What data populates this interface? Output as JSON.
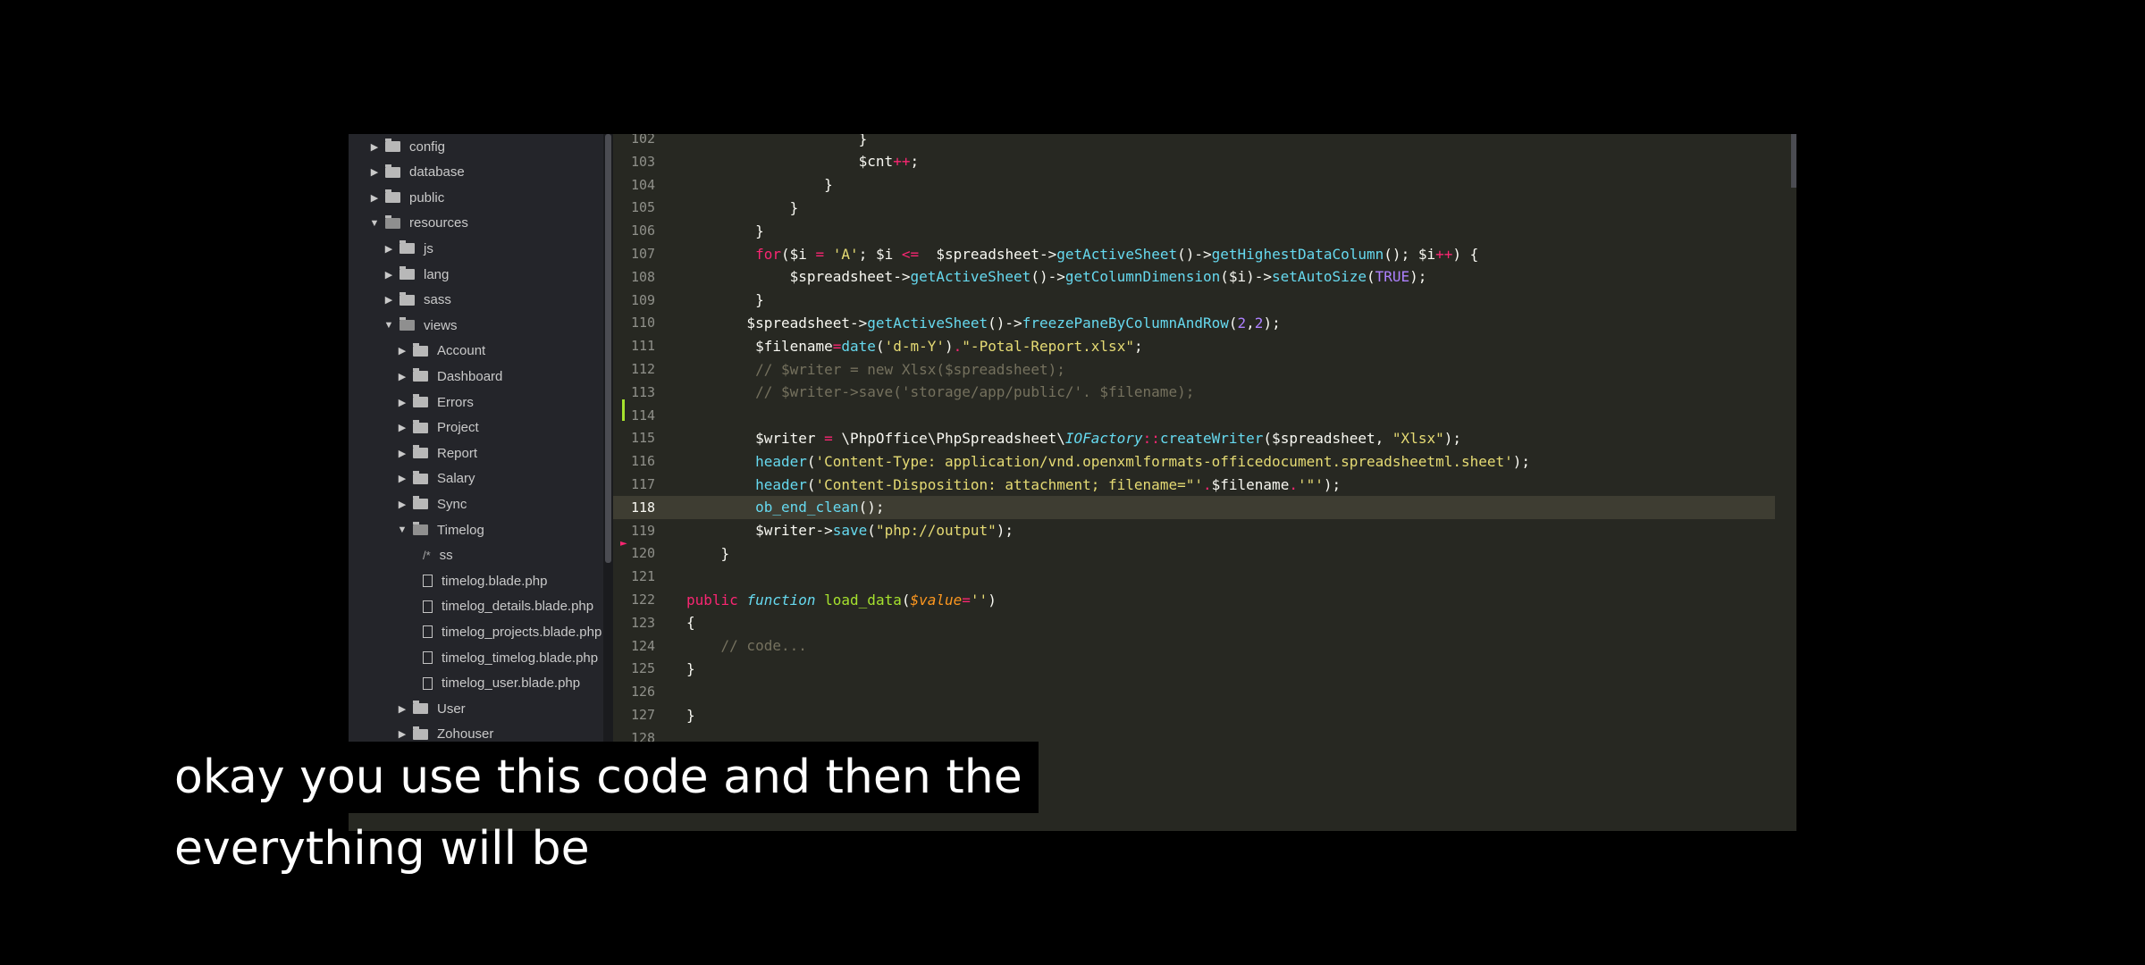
{
  "sidebar": {
    "items": [
      {
        "label": "config",
        "type": "folder",
        "depth": 0,
        "open": false
      },
      {
        "label": "database",
        "type": "folder",
        "depth": 0,
        "open": false
      },
      {
        "label": "public",
        "type": "folder",
        "depth": 0,
        "open": false
      },
      {
        "label": "resources",
        "type": "folder",
        "depth": 0,
        "open": true
      },
      {
        "label": "js",
        "type": "folder",
        "depth": 1,
        "open": false
      },
      {
        "label": "lang",
        "type": "folder",
        "depth": 1,
        "open": false
      },
      {
        "label": "sass",
        "type": "folder",
        "depth": 1,
        "open": false
      },
      {
        "label": "views",
        "type": "folder",
        "depth": 1,
        "open": true
      },
      {
        "label": "Account",
        "type": "folder",
        "depth": 2,
        "open": false
      },
      {
        "label": "Dashboard",
        "type": "folder",
        "depth": 2,
        "open": false
      },
      {
        "label": "Errors",
        "type": "folder",
        "depth": 2,
        "open": false
      },
      {
        "label": "Project",
        "type": "folder",
        "depth": 2,
        "open": false
      },
      {
        "label": "Report",
        "type": "folder",
        "depth": 2,
        "open": false
      },
      {
        "label": "Salary",
        "type": "folder",
        "depth": 2,
        "open": false
      },
      {
        "label": "Sync",
        "type": "folder",
        "depth": 2,
        "open": false
      },
      {
        "label": "Timelog",
        "type": "folder",
        "depth": 2,
        "open": true
      },
      {
        "label": "ss",
        "type": "comment",
        "depth": 3
      },
      {
        "label": "timelog.blade.php",
        "type": "file",
        "depth": 3
      },
      {
        "label": "timelog_details.blade.php",
        "type": "file",
        "depth": 3
      },
      {
        "label": "timelog_projects.blade.php",
        "type": "file",
        "depth": 3
      },
      {
        "label": "timelog_timelog.blade.php",
        "type": "file",
        "depth": 3
      },
      {
        "label": "timelog_user.blade.php",
        "type": "file",
        "depth": 3
      },
      {
        "label": "User",
        "type": "folder",
        "depth": 2,
        "open": false
      },
      {
        "label": "Zohouser",
        "type": "folder",
        "depth": 2,
        "open": false
      }
    ]
  },
  "editor": {
    "current_line": "118",
    "lines": [
      {
        "n": "102",
        "tokens": [
          [
            "var",
            "                    }"
          ]
        ]
      },
      {
        "n": "103",
        "tokens": [
          [
            "var",
            "                    $cnt"
          ],
          [
            "kw",
            "++"
          ],
          [
            "var",
            ";"
          ]
        ]
      },
      {
        "n": "104",
        "tokens": [
          [
            "var",
            "                }"
          ]
        ]
      },
      {
        "n": "105",
        "tokens": [
          [
            "var",
            "            }"
          ]
        ]
      },
      {
        "n": "106",
        "tokens": [
          [
            "var",
            "        }"
          ]
        ]
      },
      {
        "n": "107",
        "tokens": [
          [
            "var",
            "        "
          ],
          [
            "kw",
            "for"
          ],
          [
            "var",
            "($i "
          ],
          [
            "kw",
            "="
          ],
          [
            "var",
            " "
          ],
          [
            "str",
            "'A'"
          ],
          [
            "var",
            "; $i "
          ],
          [
            "kw",
            "<="
          ],
          [
            "var",
            "  $spreadsheet->"
          ],
          [
            "fn",
            "getActiveSheet"
          ],
          [
            "var",
            "()->"
          ],
          [
            "fn",
            "getHighestDataColumn"
          ],
          [
            "var",
            "(); $i"
          ],
          [
            "kw",
            "++"
          ],
          [
            "var",
            ") {"
          ]
        ]
      },
      {
        "n": "108",
        "tokens": [
          [
            "var",
            "            $spreadsheet->"
          ],
          [
            "fn",
            "getActiveSheet"
          ],
          [
            "var",
            "()->"
          ],
          [
            "fn",
            "getColumnDimension"
          ],
          [
            "var",
            "($i)->"
          ],
          [
            "fn",
            "setAutoSize"
          ],
          [
            "var",
            "("
          ],
          [
            "num",
            "TRUE"
          ],
          [
            "var",
            ");"
          ]
        ]
      },
      {
        "n": "109",
        "tokens": [
          [
            "var",
            "        }"
          ]
        ]
      },
      {
        "n": "110",
        "tokens": [
          [
            "var",
            "       $spreadsheet->"
          ],
          [
            "fn",
            "getActiveSheet"
          ],
          [
            "var",
            "()->"
          ],
          [
            "fn",
            "freezePaneByColumnAndRow"
          ],
          [
            "var",
            "("
          ],
          [
            "num",
            "2"
          ],
          [
            "var",
            ","
          ],
          [
            "num",
            "2"
          ],
          [
            "var",
            ");"
          ]
        ]
      },
      {
        "n": "111",
        "tokens": [
          [
            "var",
            "        $filename"
          ],
          [
            "kw",
            "="
          ],
          [
            "fn",
            "date"
          ],
          [
            "var",
            "("
          ],
          [
            "str",
            "'d-m-Y'"
          ],
          [
            "var",
            ")"
          ],
          [
            "kw",
            "."
          ],
          [
            "str",
            "\"-Potal-Report.xlsx\""
          ],
          [
            "var",
            ";"
          ]
        ]
      },
      {
        "n": "112",
        "tokens": [
          [
            "cmt",
            "        // $writer = new Xlsx($spreadsheet);"
          ]
        ]
      },
      {
        "n": "113",
        "tokens": [
          [
            "cmt",
            "        // $writer->save('storage/app/public/'. $filename);"
          ]
        ]
      },
      {
        "n": "114",
        "tokens": [
          [
            "var",
            ""
          ]
        ]
      },
      {
        "n": "115",
        "tokens": [
          [
            "var",
            "        $writer "
          ],
          [
            "kw",
            "="
          ],
          [
            "var",
            " \\PhpOffice\\PhpSpreadsheet\\"
          ],
          [
            "fn-italic",
            "IOFactory"
          ],
          [
            "kw",
            "::"
          ],
          [
            "fn",
            "createWriter"
          ],
          [
            "var",
            "($spreadsheet, "
          ],
          [
            "str",
            "\"Xlsx\""
          ],
          [
            "var",
            ");"
          ]
        ]
      },
      {
        "n": "116",
        "tokens": [
          [
            "var",
            "        "
          ],
          [
            "fn",
            "header"
          ],
          [
            "var",
            "("
          ],
          [
            "str",
            "'Content-Type: application/vnd.openxmlformats-officedocument.spreadsheetml.sheet'"
          ],
          [
            "var",
            ");"
          ]
        ]
      },
      {
        "n": "117",
        "tokens": [
          [
            "var",
            "        "
          ],
          [
            "fn",
            "header"
          ],
          [
            "var",
            "("
          ],
          [
            "str",
            "'Content-Disposition: attachment; filename=\"'"
          ],
          [
            "kw",
            "."
          ],
          [
            "var",
            "$filename"
          ],
          [
            "kw",
            "."
          ],
          [
            "str",
            "'\"'"
          ],
          [
            "var",
            ");"
          ]
        ]
      },
      {
        "n": "118",
        "tokens": [
          [
            "var",
            "        "
          ],
          [
            "fn",
            "ob_end_clean"
          ],
          [
            "var",
            "();"
          ]
        ]
      },
      {
        "n": "119",
        "tokens": [
          [
            "var",
            "        $writer->"
          ],
          [
            "fn",
            "save"
          ],
          [
            "var",
            "("
          ],
          [
            "str",
            "\"php://output\""
          ],
          [
            "var",
            ");"
          ]
        ]
      },
      {
        "n": "120",
        "tokens": [
          [
            "var",
            "    }"
          ]
        ]
      },
      {
        "n": "121",
        "tokens": [
          [
            "var",
            ""
          ]
        ]
      },
      {
        "n": "122",
        "tokens": [
          [
            "kw",
            "public"
          ],
          [
            "var",
            " "
          ],
          [
            "fn-italic",
            "function"
          ],
          [
            "var",
            " "
          ],
          [
            "green",
            "load_data"
          ],
          [
            "var",
            "("
          ],
          [
            "param",
            "$value"
          ],
          [
            "kw",
            "="
          ],
          [
            "str",
            "''"
          ],
          [
            "var",
            ")"
          ]
        ]
      },
      {
        "n": "123",
        "tokens": [
          [
            "var",
            "{"
          ]
        ]
      },
      {
        "n": "124",
        "tokens": [
          [
            "cmt",
            "    // code..."
          ]
        ]
      },
      {
        "n": "125",
        "tokens": [
          [
            "var",
            "}"
          ]
        ]
      },
      {
        "n": "126",
        "tokens": [
          [
            "var",
            ""
          ]
        ]
      },
      {
        "n": "127",
        "tokens": [
          [
            "var",
            "}"
          ]
        ]
      },
      {
        "n": "128",
        "tokens": [
          [
            "var",
            ""
          ]
        ]
      }
    ]
  },
  "caption": {
    "line1": "okay you use this code and then the",
    "line2": "everything will be"
  },
  "colors": {
    "background": "#000000",
    "editor_bg": "#272822",
    "sidebar_bg": "#24252a",
    "keyword": "#f92672",
    "function": "#66d9ef",
    "string": "#e6db74",
    "comment": "#75715e"
  }
}
